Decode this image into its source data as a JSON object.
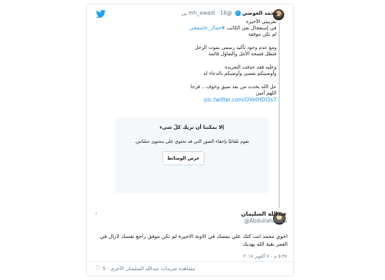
{
  "tweet1": {
    "name": "محمد العوضي",
    "handle": "@mh_awadi",
    "time": "16 ين",
    "lines": [
      "تعربيتي الأخيرة",
      "في إستعجال نعي الكاتب #جمال_خاشقجي",
      "لم تكن موفقة",
      "",
      "ومع عدم وجود تأكيد رسمي بموت الرجل",
      "فتظل فسحة الأمل والتفاؤل قائمة",
      "",
      "وعليه فقد حذفت التغريدة",
      "وأوصيتكم نفسي وأوصيكم بالدعاء له",
      "",
      "عل الله يحدث من بعد ضيق وخوف .. فرجا",
      "اللهم آمين"
    ],
    "link": "pic.twitter.com/OVetHDI3s7"
  },
  "sensitive": {
    "title": "إلا يمكننا أن نريك كلّ شيء",
    "description": "تقوم تلقائيًا بإخفاء الصور التي قد تحتوي على محتوى حسّاس.",
    "button_label": "عرض الوسائط"
  },
  "tweet2": {
    "name": "عبدالله السليمان",
    "handle": "@AbdullahAls15",
    "text": "اخوي محمد انت كثك علي بمصك في الاونة الاخيرة لم تكن موفق راجع نفسك لازال في العمر بقية الله يهديك",
    "time": "٥:٣٨ م - ٧ أكتوبر ٢٠١٨",
    "like_count": "5",
    "footer_link": "مشاهدة تغريدات عبدالله السليمان الأخرى",
    "caret": "›"
  },
  "icons": {
    "twitter": "twitter-bird-icon",
    "verified": "verified-badge-icon",
    "heart": "heart-icon"
  },
  "colors": {
    "accent": "#1da1f2",
    "link": "#1b95e0",
    "muted": "#657786"
  }
}
